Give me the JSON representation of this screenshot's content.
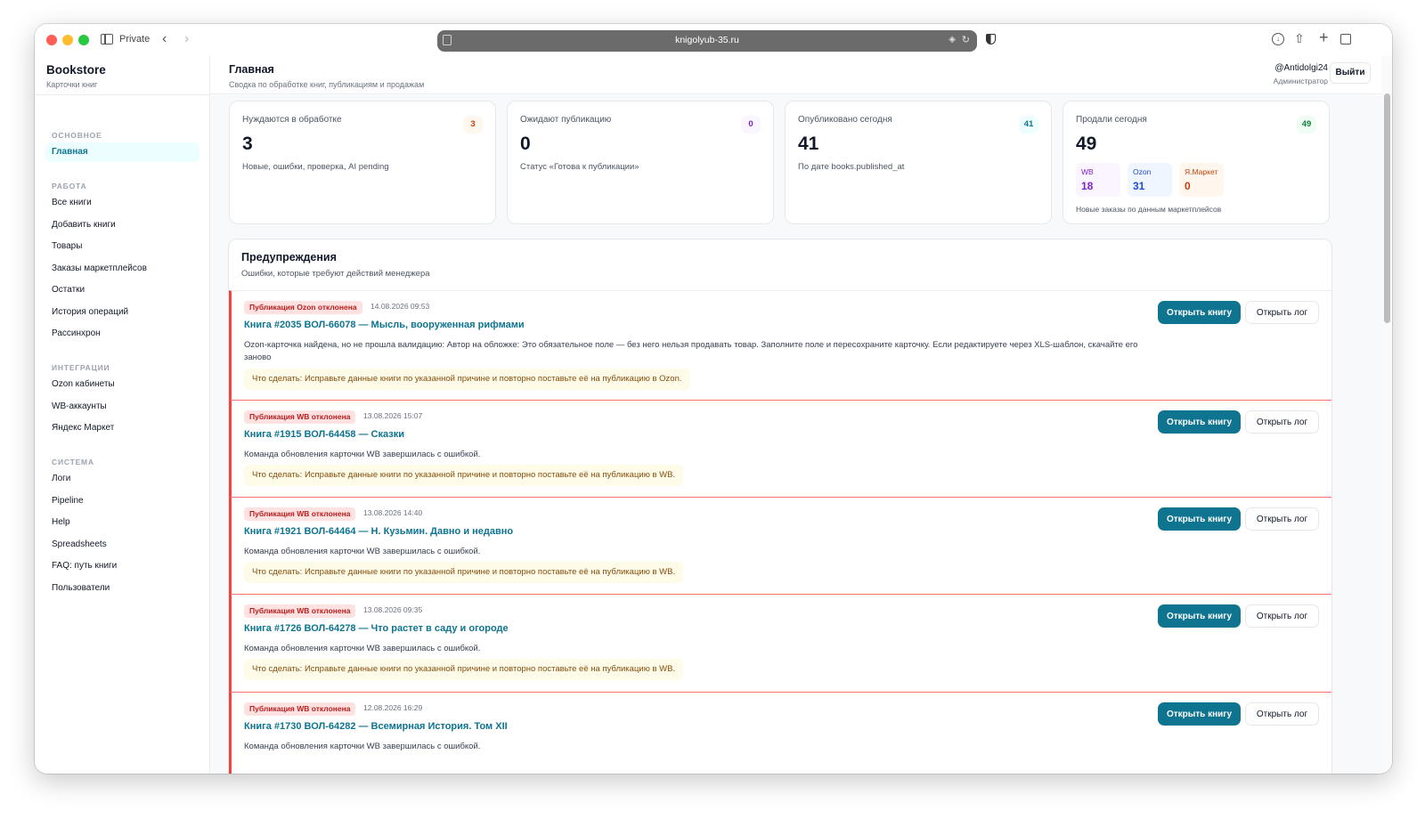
{
  "browser": {
    "private_label": "Private",
    "url": "knigolyub-35.ru"
  },
  "brand": {
    "title": "Bookstore",
    "subtitle": "Карточки книг"
  },
  "nav": {
    "sections": [
      {
        "label": "ОСНОВНОЕ",
        "items": [
          {
            "label": "Главная",
            "active": true
          }
        ]
      },
      {
        "label": "РАБОТА",
        "items": [
          {
            "label": "Все книги"
          },
          {
            "label": "Добавить книги"
          },
          {
            "label": "Товары"
          },
          {
            "label": "Заказы маркетплейсов"
          },
          {
            "label": "Остатки"
          },
          {
            "label": "История операций"
          },
          {
            "label": "Рассинхрон"
          }
        ]
      },
      {
        "label": "ИНТЕГРАЦИИ",
        "items": [
          {
            "label": "Ozon кабинеты"
          },
          {
            "label": "WB-аккаунты"
          },
          {
            "label": "Яндекс Маркет"
          }
        ]
      },
      {
        "label": "СИСТЕМА",
        "items": [
          {
            "label": "Логи"
          },
          {
            "label": "Pipeline"
          },
          {
            "label": "Help"
          },
          {
            "label": "Spreadsheets"
          },
          {
            "label": "FAQ: путь книги"
          },
          {
            "label": "Пользователи"
          }
        ]
      }
    ]
  },
  "header": {
    "title": "Главная",
    "subtitle": "Сводка по обработке книг, публикациям и продажам",
    "user": "@Antidolgi24",
    "role": "Администратор",
    "logout": "Выйти"
  },
  "stats": [
    {
      "label": "Нуждаются в обработке",
      "badge": "3",
      "value": "3",
      "desc": "Новые, ошибки, проверка, AI pending",
      "badge_color": "#c2410c",
      "badge_bg": "#fff7ed"
    },
    {
      "label": "Ожидают публикацию",
      "badge": "0",
      "value": "0",
      "desc": "Статус «Готова к публикации»",
      "badge_color": "#7e22ce",
      "badge_bg": "#faf5ff"
    },
    {
      "label": "Опубликовано сегодня",
      "badge": "41",
      "value": "41",
      "desc": "По дате books.published_at",
      "badge_color": "#0e7490",
      "badge_bg": "#ecfeff"
    },
    {
      "label": "Продали сегодня",
      "badge": "49",
      "value": "49",
      "desc": "Новые заказы по данным маркетплейсов",
      "badge_color": "#15803d",
      "badge_bg": "#f0fdf4"
    }
  ],
  "marketplaces": [
    {
      "name": "WB",
      "value": "18",
      "color": "#7e22ce",
      "bg": "#faf5ff"
    },
    {
      "name": "Ozon",
      "value": "31",
      "color": "#1d4ed8",
      "bg": "#eff6ff"
    },
    {
      "name": "Я.Маркет",
      "value": "0",
      "color": "#c2410c",
      "bg": "#fff7ed"
    }
  ],
  "warnings": {
    "title": "Предупреждения",
    "subtitle": "Ошибки, которые требуют действий менеджера",
    "open_book": "Открыть книгу",
    "open_log": "Открыть лог",
    "items": [
      {
        "badge": "Публикация Ozon отклонена",
        "time": "14.08.2026 09:53",
        "book": "Книга #2035 ВОЛ-66078 — Мысль, вооруженная рифмами",
        "message": "Ozon-карточка найдена, но не прошла валидацию: Автор на обложке: Это обязательное поле — без него нельзя продавать товар. Заполните поле и пересохраните карточку. Если редактируете через XLS-шаблон, скачайте его заново",
        "todo": "Что сделать: Исправьте данные книги по указанной причине и повторно поставьте её на публикацию в Ozon."
      },
      {
        "badge": "Публикация WB отклонена",
        "time": "13.08.2026 15:07",
        "book": "Книга #1915 ВОЛ-64458 — Сказки",
        "message": "Команда обновления карточки WB завершилась с ошибкой.",
        "todo": "Что сделать: Исправьте данные книги по указанной причине и повторно поставьте её на публикацию в WB."
      },
      {
        "badge": "Публикация WB отклонена",
        "time": "13.08.2026 14:40",
        "book": "Книга #1921 ВОЛ-64464 — Н. Кузьмин. Давно и недавно",
        "message": "Команда обновления карточки WB завершилась с ошибкой.",
        "todo": "Что сделать: Исправьте данные книги по указанной причине и повторно поставьте её на публикацию в WB."
      },
      {
        "badge": "Публикация WB отклонена",
        "time": "13.08.2026 09:35",
        "book": "Книга #1726 ВОЛ-64278 — Что растет в саду и огороде",
        "message": "Команда обновления карточки WB завершилась с ошибкой.",
        "todo": "Что сделать: Исправьте данные книги по указанной причине и повторно поставьте её на публикацию в WB."
      },
      {
        "badge": "Публикация WB отклонена",
        "time": "12.08.2026 16:29",
        "book": "Книга #1730 ВОЛ-64282 — Всемирная История. Том XII",
        "message": "Команда обновления карточки WB завершилась с ошибкой.",
        "todo": ""
      }
    ]
  }
}
